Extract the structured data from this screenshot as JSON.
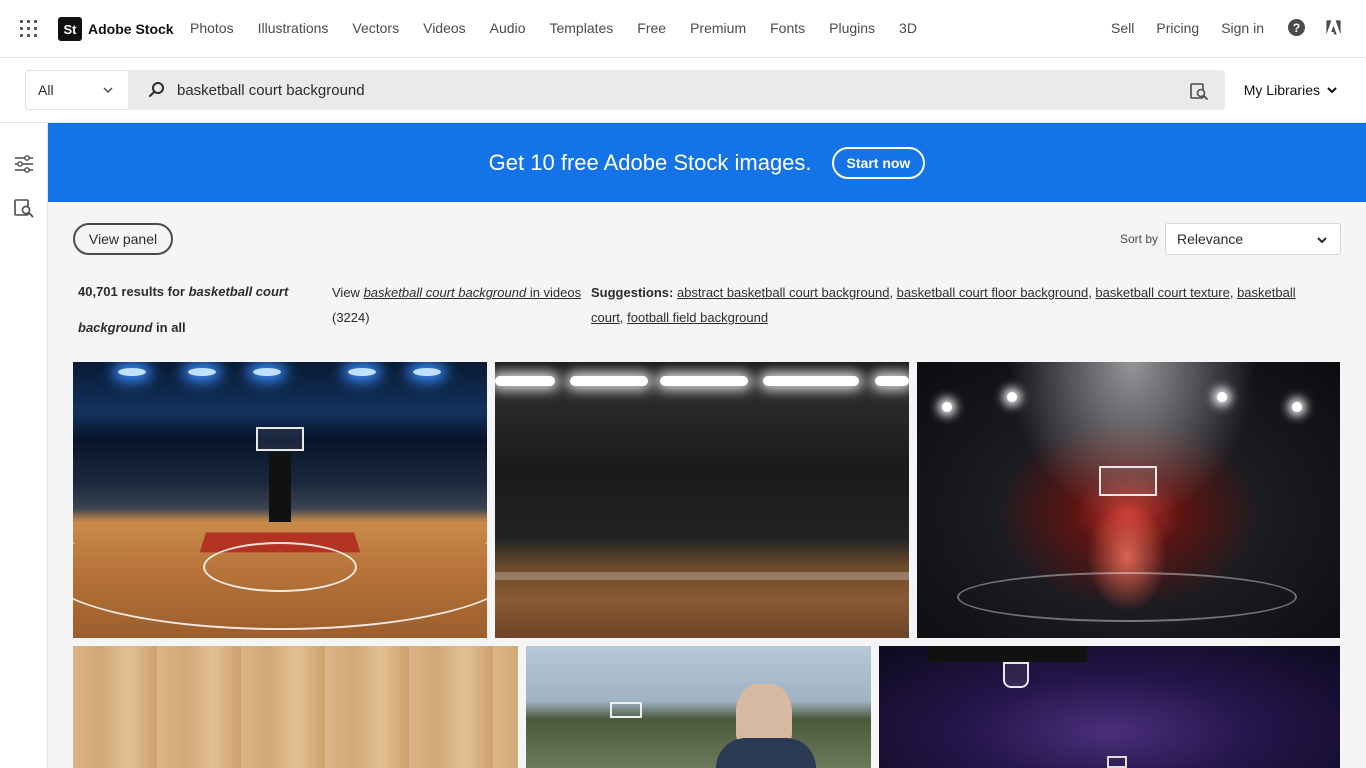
{
  "nav": {
    "brand_badge": "St",
    "brand_name": "Adobe Stock",
    "links": [
      "Photos",
      "Illustrations",
      "Vectors",
      "Videos",
      "Audio",
      "Templates",
      "Free",
      "Premium",
      "Fonts",
      "Plugins",
      "3D"
    ],
    "sell": "Sell",
    "pricing": "Pricing",
    "sign_in": "Sign in",
    "help_glyph": "?"
  },
  "search": {
    "filter_value": "All",
    "query": "basketball court background",
    "my_libraries": "My Libraries"
  },
  "banner": {
    "text": "Get 10 free Adobe Stock images.",
    "button": "Start now",
    "color": "#1473e6"
  },
  "controls": {
    "view_panel": "View panel",
    "sort_label": "Sort by",
    "sort_value": "Relevance"
  },
  "results": {
    "count": "40,701",
    "for_text": "results for",
    "query": "basketball court background",
    "in_all": "in all",
    "view_prefix": "View",
    "view_query": "basketball court background",
    "view_suffix": "in videos",
    "video_count": "(3224)",
    "suggestions_label": "Suggestions:",
    "suggestions": [
      "abstract basketball court background",
      "basketball court floor background",
      "basketball court texture",
      "basketball court",
      "football field background"
    ]
  },
  "icons": {
    "apps": "apps-grid-icon",
    "search": "search-icon",
    "visual_search": "visual-search-icon",
    "filters": "filters-icon",
    "help": "help-icon",
    "adobe": "adobe-logo-icon",
    "chevron": "chevron-down-icon"
  }
}
